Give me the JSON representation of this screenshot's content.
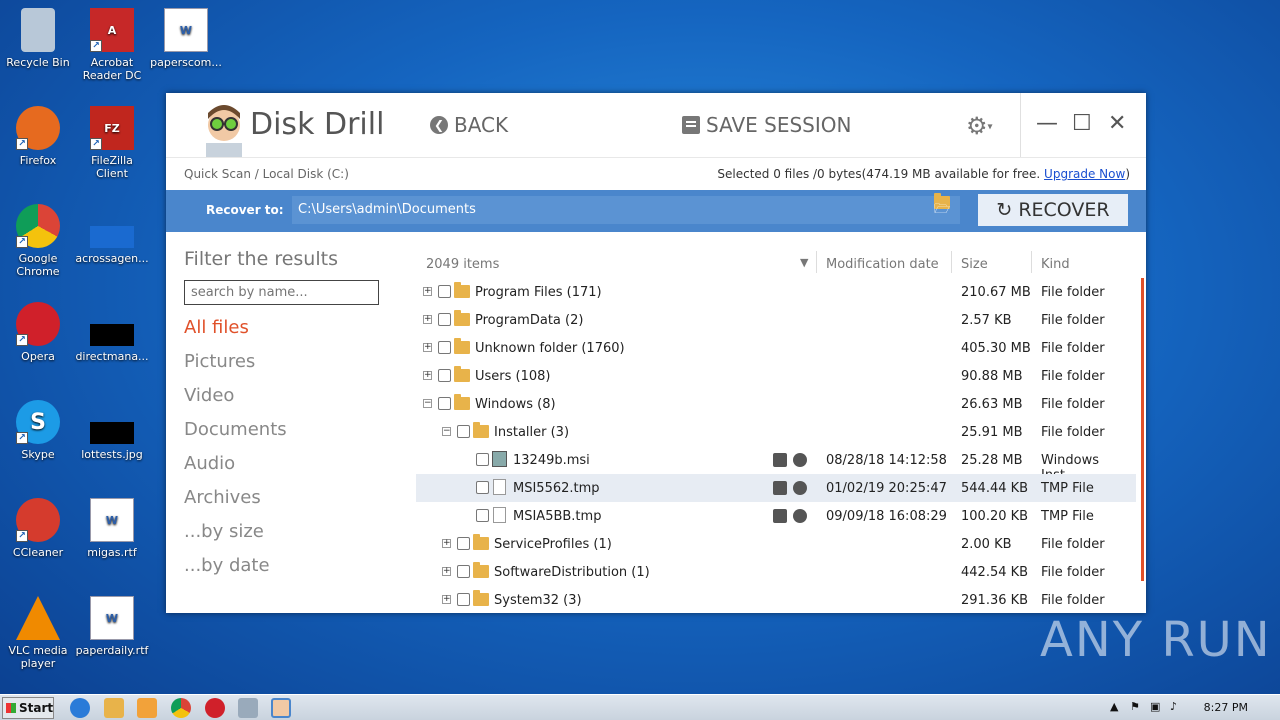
{
  "desktop": {
    "icons": [
      {
        "label": "Recycle Bin",
        "color": "#9fb7cf"
      },
      {
        "label": "Acrobat Reader DC",
        "color": "#c62828"
      },
      {
        "label": "paperscom...",
        "color": "#2b5eaa"
      },
      {
        "label": "Firefox",
        "color": "#e66a1f"
      },
      {
        "label": "FileZilla Client",
        "color": "#c0261e"
      },
      {
        "label": "Google Chrome",
        "color": "#4a9a43"
      },
      {
        "label": "acrossagen...",
        "color": "#1565c0"
      },
      {
        "label": "Opera",
        "color": "#d0202a"
      },
      {
        "label": "directmana...",
        "color": "#000000"
      },
      {
        "label": "Skype",
        "color": "#1c9be6"
      },
      {
        "label": "lottests.jpg",
        "color": "#000000"
      },
      {
        "label": "CCleaner",
        "color": "#d53b2d"
      },
      {
        "label": "migas.rtf",
        "color": "#2b5eaa"
      },
      {
        "label": "VLC media player",
        "color": "#f08a00"
      },
      {
        "label": "paperdaily.rtf",
        "color": "#2b5eaa"
      }
    ]
  },
  "app": {
    "title": "Disk Drill",
    "back_label": "BACK",
    "save_label": "SAVE SESSION",
    "breadcrumb": "Quick Scan / Local Disk (C:)",
    "selection_info": "Selected 0 files /0 bytes(474.19 MB available for free.",
    "upgrade_link": "Upgrade Now",
    "selection_close": ")",
    "recover_to_label": "Recover to:",
    "recover_path": "C:\\Users\\admin\\Documents",
    "recover_button": "RECOVER"
  },
  "filter": {
    "title": "Filter the results",
    "search_placeholder": "search by name...",
    "categories": [
      "All files",
      "Pictures",
      "Video",
      "Documents",
      "Audio",
      "Archives",
      "...by size",
      "...by date"
    ]
  },
  "table": {
    "count": "2049 items",
    "headers": {
      "date": "Modification date",
      "size": "Size",
      "kind": "Kind"
    },
    "rows": [
      {
        "name": "Program Files (171)",
        "date": "",
        "size": "210.67 MB",
        "kind": "File folder"
      },
      {
        "name": "ProgramData (2)",
        "date": "",
        "size": "2.57 KB",
        "kind": "File folder"
      },
      {
        "name": "Unknown folder (1760)",
        "date": "",
        "size": "405.30 MB",
        "kind": "File folder"
      },
      {
        "name": "Users (108)",
        "date": "",
        "size": "90.88 MB",
        "kind": "File folder"
      },
      {
        "name": "Windows (8)",
        "date": "",
        "size": "26.63 MB",
        "kind": "File folder"
      },
      {
        "name": "Installer (3)",
        "date": "",
        "size": "25.91 MB",
        "kind": "File folder"
      },
      {
        "name": "13249b.msi",
        "date": "08/28/18 14:12:58",
        "size": "25.28 MB",
        "kind": "Windows Inst..."
      },
      {
        "name": "MSI5562.tmp",
        "date": "01/02/19 20:25:47",
        "size": "544.44 KB",
        "kind": "TMP File"
      },
      {
        "name": "MSIA5BB.tmp",
        "date": "09/09/18 16:08:29",
        "size": "100.20 KB",
        "kind": "TMP File"
      },
      {
        "name": "ServiceProfiles (1)",
        "date": "",
        "size": "2.00 KB",
        "kind": "File folder"
      },
      {
        "name": "SoftwareDistribution (1)",
        "date": "",
        "size": "442.54 KB",
        "kind": "File folder"
      },
      {
        "name": "System32 (3)",
        "date": "",
        "size": "291.36 KB",
        "kind": "File folder"
      }
    ]
  },
  "taskbar": {
    "start_label": "Start",
    "clock": "8:27 PM"
  },
  "watermark": "ANY RUN",
  "colors": {
    "accent": "#e0512a",
    "recover_bar": "#4a86cc",
    "link": "#1a4fd0"
  }
}
